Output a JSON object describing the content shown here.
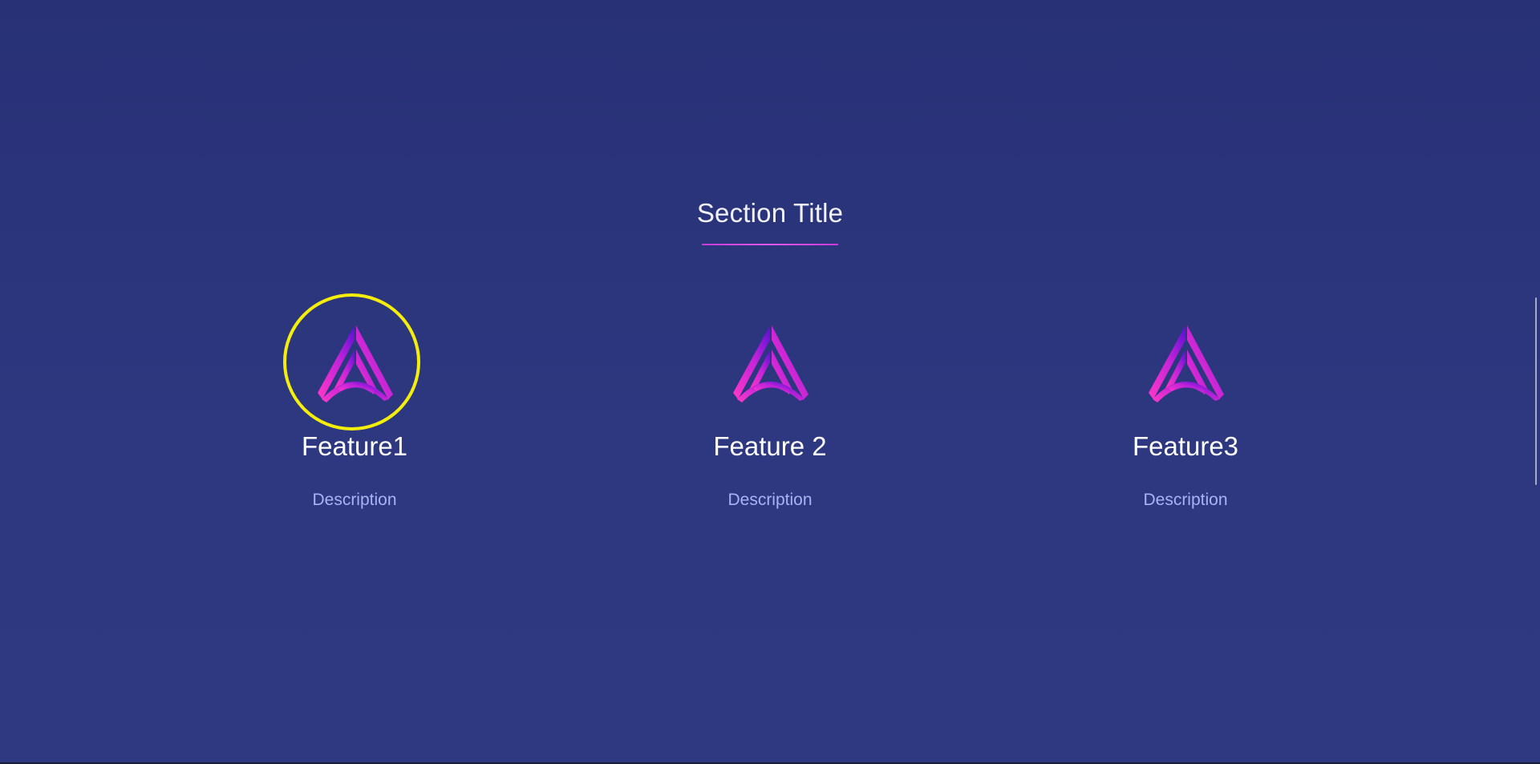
{
  "section": {
    "title": "Section Title"
  },
  "features": [
    {
      "name": "Feature1",
      "description": "Description"
    },
    {
      "name": "Feature 2",
      "description": "Description"
    },
    {
      "name": "Feature3",
      "description": "Description"
    }
  ],
  "icons": {
    "feature_logo": "triangle-logo-icon"
  },
  "colors": {
    "background": "#2b3479",
    "title_text": "#f2f2fb",
    "underline": "#d24ae0",
    "feature_name": "#ffffff",
    "description": "#a6b3f4",
    "logo_gradient_start": "#f032c8",
    "logo_gradient_end": "#6a10d8",
    "highlight_ring": "#f5ee0a"
  }
}
